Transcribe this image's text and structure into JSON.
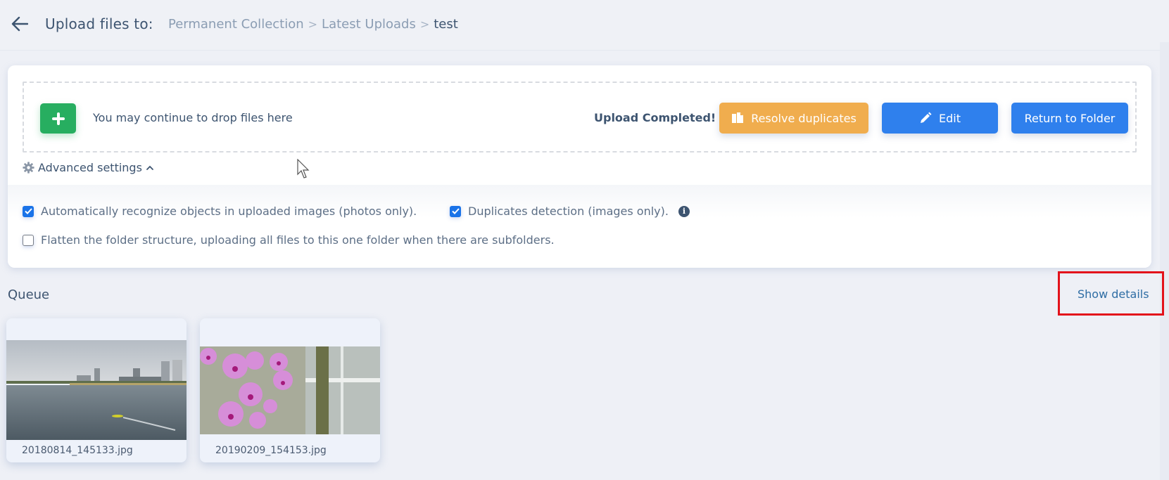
{
  "header": {
    "title": "Upload files to:",
    "back_icon": "arrow-left-icon",
    "breadcrumb": [
      {
        "label": "Permanent Collection"
      },
      {
        "label": "Latest Uploads"
      },
      {
        "label": "test"
      }
    ],
    "separator": ">"
  },
  "uploader": {
    "add_icon": "plus-icon",
    "drop_text": "You may continue to drop files here",
    "status": "Upload Completed!",
    "buttons": {
      "resolve": {
        "label": "Resolve duplicates",
        "icon": "copy-files-icon",
        "color": "#f0ad4e"
      },
      "edit": {
        "label": "Edit",
        "icon": "pencil-icon",
        "color": "#2f80ed"
      },
      "return": {
        "label": "Return to Folder",
        "color": "#2f80ed"
      }
    },
    "advanced": {
      "label": "Advanced settings",
      "icon": "gear-icon",
      "expanded": true,
      "options": [
        {
          "label": "Automatically recognize objects in uploaded images (photos only).",
          "checked": true
        },
        {
          "label": "Duplicates detection (images only).",
          "checked": true,
          "info_icon": "info-circle-icon"
        },
        {
          "label": "Flatten the folder structure, uploading all files to this one folder when there are subfolders.",
          "checked": false
        }
      ]
    }
  },
  "queue": {
    "title": "Queue",
    "show_details": "Show details",
    "items": [
      {
        "filename": "20180814_145133.jpg",
        "description": "river with kayaker and city skyline"
      },
      {
        "filename": "20190209_154153.jpg",
        "description": "pink orchid flowers"
      }
    ]
  },
  "colors": {
    "accent_blue": "#2f80ed",
    "success_green": "#27ae60",
    "warning_orange": "#f0ad4e",
    "highlight_red": "#e3121b"
  }
}
